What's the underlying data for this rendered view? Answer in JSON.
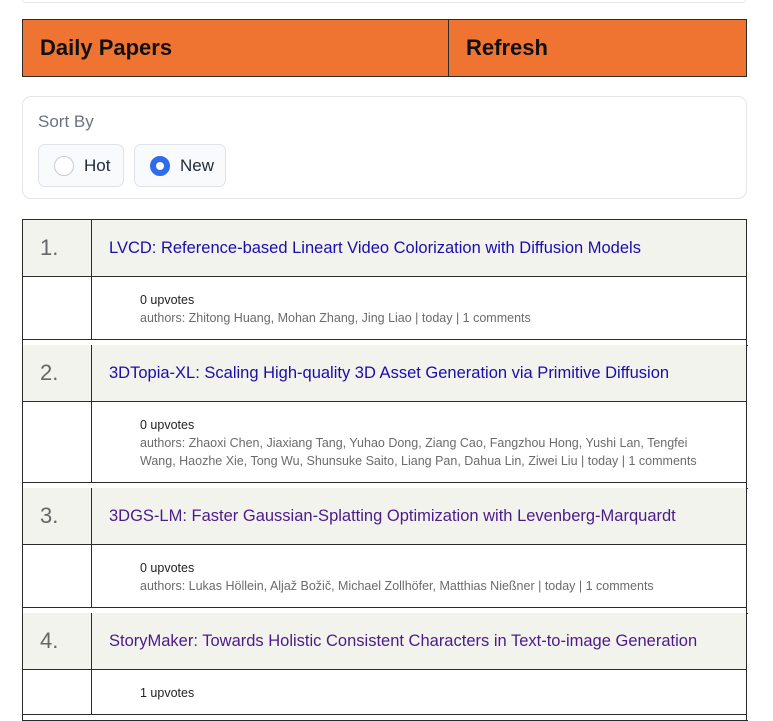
{
  "header": {
    "title": "Daily Papers",
    "refresh_label": "Refresh"
  },
  "sort": {
    "label": "Sort By",
    "options": [
      {
        "label": "Hot",
        "selected": false
      },
      {
        "label": "New",
        "selected": true
      }
    ]
  },
  "papers": [
    {
      "rank": "1.",
      "title": "LVCD: Reference-based Lineart Video Colorization with Diffusion Models",
      "upvotes": "0 upvotes",
      "meta": "authors: Zhitong Huang, Mohan Zhang, Jing Liao | today | 1 comments"
    },
    {
      "rank": "2.",
      "title": "3DTopia-XL: Scaling High-quality 3D Asset Generation via Primitive Diffusion",
      "upvotes": "0 upvotes",
      "meta": "authors: Zhaoxi Chen, Jiaxiang Tang, Yuhao Dong, Ziang Cao, Fangzhou Hong, Yushi Lan, Tengfei Wang, Haozhe Xie, Tong Wu, Shunsuke Saito, Liang Pan, Dahua Lin, Ziwei Liu | today | 1 comments"
    },
    {
      "rank": "3.",
      "title": "3DGS-LM: Faster Gaussian-Splatting Optimization with Levenberg-Marquardt",
      "upvotes": "0 upvotes",
      "meta": "authors: Lukas Höllein, Aljaž Božič, Michael Zollhöfer, Matthias Nießner | today | 1 comments"
    },
    {
      "rank": "4.",
      "title": "StoryMaker: Towards Holistic Consistent Characters in Text-to-image Generation",
      "upvotes": "1 upvotes",
      "meta": ""
    }
  ],
  "colors": {
    "header_bg": "#ef7331",
    "link_unvisited": "#1a0dab",
    "link_visited": "#4b1b8a",
    "radio_selected": "#2f6bec"
  }
}
